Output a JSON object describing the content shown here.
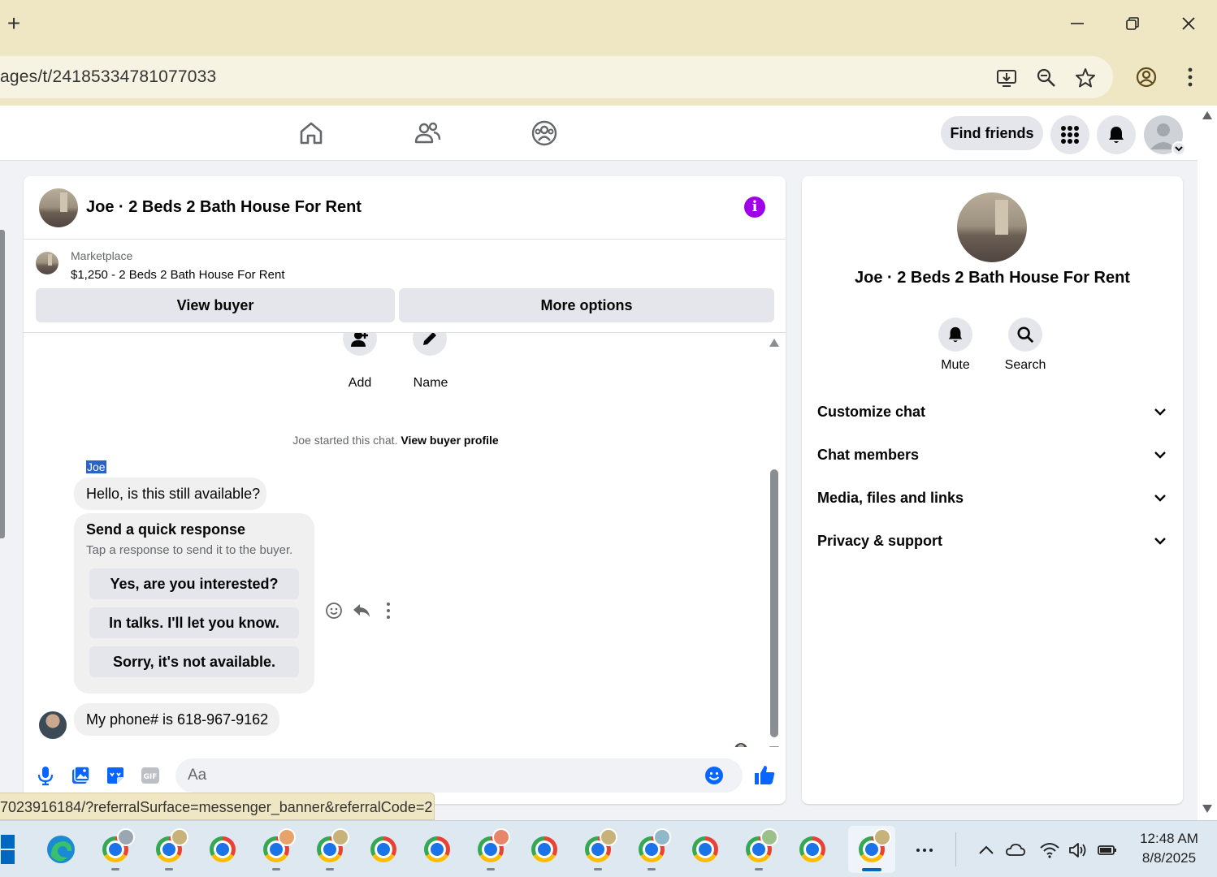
{
  "browser": {
    "url": "ages/t/24185334781077033",
    "status_url": "7023916184/?referralSurface=messenger_banner&referralCode=2"
  },
  "fbnav": {
    "find_friends": "Find friends"
  },
  "chat": {
    "title": "Joe · 2 Beds 2 Bath House For Rent",
    "marketplace_label": "Marketplace",
    "listing": "$1,250 - 2 Beds 2 Bath House For Rent",
    "view_buyer": "View buyer",
    "more_options": "More options",
    "add_label": "Add",
    "name_label": "Name",
    "started_text": "Joe started this chat.",
    "started_link": "View buyer profile",
    "sender": "Joe",
    "message1": "Hello, is this still available?",
    "quick_title": "Send a quick response",
    "quick_sub": "Tap a response to send it to the buyer.",
    "quick_replies": [
      "Yes, are you interested?",
      "In talks. I'll let you know.",
      "Sorry, it's not available."
    ],
    "message2": "My phone# is 618-967-9162",
    "composer_placeholder": "Aa"
  },
  "info": {
    "name": "Joe · 2 Beds 2 Bath House For Rent",
    "mute": "Mute",
    "search": "Search",
    "sections": [
      "Customize chat",
      "Chat members",
      "Media, files and links",
      "Privacy & support"
    ]
  },
  "taskbar": {
    "time": "12:48 AM",
    "date": "8/8/2025"
  },
  "colors": {
    "fb_blue": "#0866ff",
    "info_purple": "#a000e8",
    "chrome_bar": "#efe6c4"
  }
}
